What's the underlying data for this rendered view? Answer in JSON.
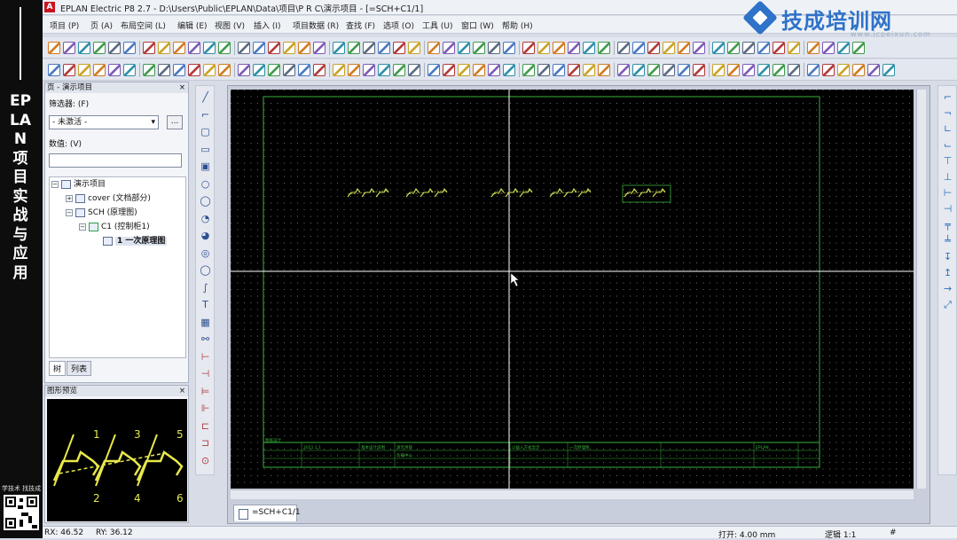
{
  "side_banner": {
    "vertical_title": "EPLAN项目实战与应用",
    "qr_caption": "学技术 找技成"
  },
  "watermark": {
    "brand": "技成培训网",
    "url": "www.jcpeixun.com"
  },
  "titlebar": {
    "app_title": "EPLAN Electric P8 2.7 - D:\\Users\\Public\\EPLAN\\Data\\项目\\P R C\\演示项目 - [=SCH+C1/1]",
    "logo_letter": "A"
  },
  "menu": [
    "项目 (P)",
    "页 (A)",
    "布局空间 (L)",
    "编辑 (E)",
    "视图 (V)",
    "插入 (I)",
    "项目数据 (R)",
    "查找 (F)",
    "选项 (O)",
    "工具 (U)",
    "窗口 (W)",
    "帮助 (H)"
  ],
  "page_navigator": {
    "title": "页 - 演示项目",
    "close": "×",
    "filter_label": "筛选器: (F)",
    "filter_value": "- 未激活 -",
    "filter_button": "...",
    "value_label": "数值: (V)",
    "tree": {
      "root": "演示项目",
      "cover": "cover (文档部分)",
      "sch": "SCH (原理图)",
      "cabinet": "C1 (控制柜1)",
      "page": "1 一次原理图"
    },
    "tabs": [
      "树",
      "列表"
    ]
  },
  "graphic_preview": {
    "title": "图形预览",
    "close": "×",
    "terminals_top": [
      "1",
      "3",
      "5"
    ],
    "terminals_bottom": [
      "2",
      "4",
      "6"
    ]
  },
  "editor": {
    "page_tab": "=SCH+C1/1",
    "symbol_count": 5,
    "titleblock_cells": [
      "图纸设计",
      "2021.1.1",
      "基本设计说明",
      "演示项目",
      "负载中心",
      "以插入方式显示",
      "一次原理图",
      "EPLAN"
    ]
  },
  "statusbar": {
    "rx": "RX: 46.52",
    "ry": "RY: 36.12",
    "grid": "打开: 4.00 mm",
    "logic": "逻辑 1:1",
    "hash": "#"
  },
  "colors": {
    "canvas": "#000000",
    "symbol": "#d9e65a",
    "frame": "#37b03c",
    "cross": "#ffffff",
    "accent": "#2e72c9"
  }
}
